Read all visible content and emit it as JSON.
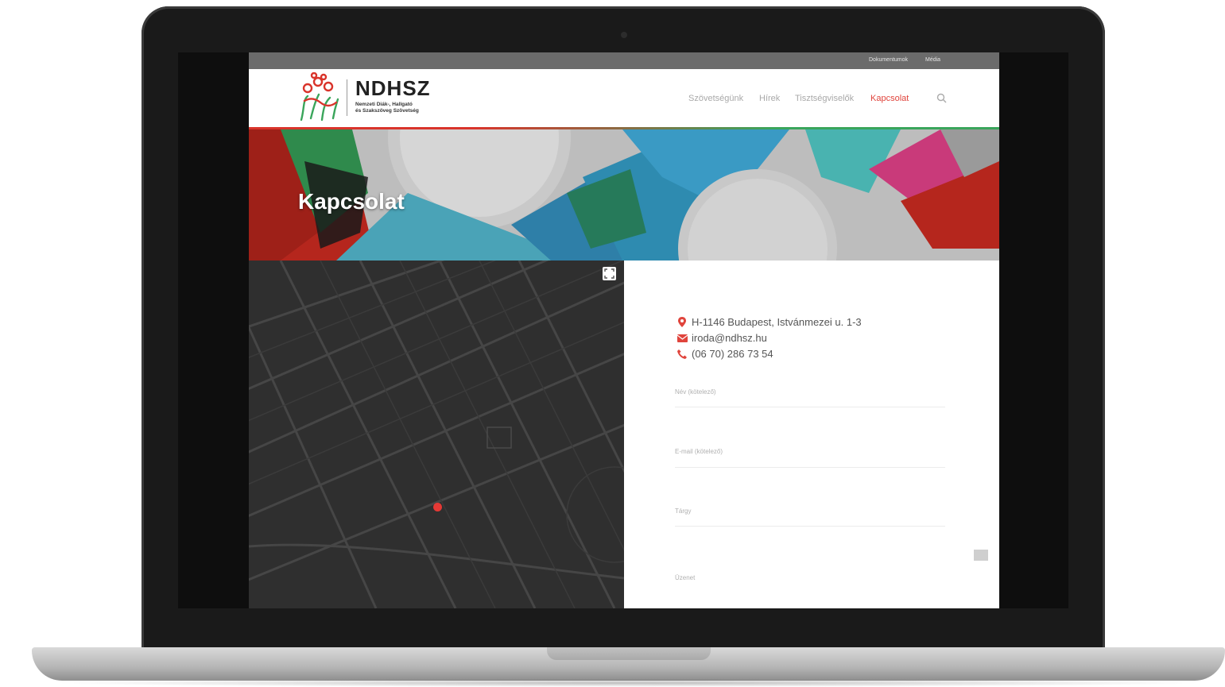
{
  "topbar": {
    "links": [
      "Dokumentumok",
      "Média"
    ]
  },
  "header": {
    "logo_title": "NDHSZ",
    "logo_sub": [
      "Nemzeti Diák-, Hallgató",
      "és Szakszöveg Szövetség"
    ],
    "nav": [
      {
        "label": "Szövetségünk",
        "active": false
      },
      {
        "label": "Hírek",
        "active": false
      },
      {
        "label": "Tisztségviselők",
        "active": false
      },
      {
        "label": "Kapcsolat",
        "active": true
      }
    ]
  },
  "hero": {
    "title": "Kapcsolat"
  },
  "contact": {
    "address": "H-1146 Budapest, Istvánmezei u. 1-3",
    "email": "iroda@ndhsz.hu",
    "phone": "(06 70) 286 73 54",
    "fields": [
      "Név (kötelező)",
      "E-mail (kötelező)",
      "Tárgy",
      "Üzenet"
    ]
  },
  "colors": {
    "accent": "#e0443c",
    "green": "#3aa55b",
    "map_bg": "#2f2f2f"
  }
}
